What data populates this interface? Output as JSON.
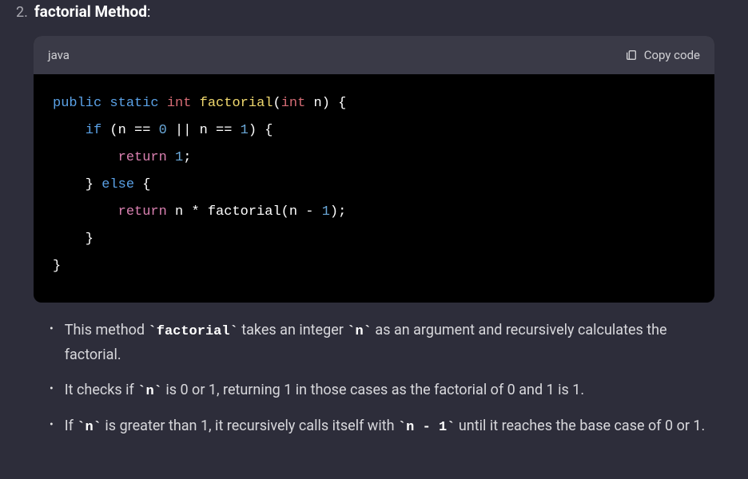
{
  "heading": {
    "number": "2.",
    "title": "factorial Method",
    "colon": ":"
  },
  "code_block": {
    "language": "java",
    "copy_label": "Copy code",
    "tokens": [
      {
        "t": "public",
        "c": "tok-keyword"
      },
      {
        "t": " "
      },
      {
        "t": "static",
        "c": "tok-keyword"
      },
      {
        "t": " "
      },
      {
        "t": "int",
        "c": "tok-type"
      },
      {
        "t": " "
      },
      {
        "t": "factorial",
        "c": "tok-func"
      },
      {
        "t": "("
      },
      {
        "t": "int",
        "c": "tok-type"
      },
      {
        "t": " n) {\n"
      },
      {
        "t": "    "
      },
      {
        "t": "if",
        "c": "tok-keyword"
      },
      {
        "t": " (n == "
      },
      {
        "t": "0",
        "c": "tok-number"
      },
      {
        "t": " || n == "
      },
      {
        "t": "1",
        "c": "tok-number"
      },
      {
        "t": ") {\n"
      },
      {
        "t": "        "
      },
      {
        "t": "return",
        "c": "tok-return"
      },
      {
        "t": " "
      },
      {
        "t": "1",
        "c": "tok-number"
      },
      {
        "t": ";\n"
      },
      {
        "t": "    } "
      },
      {
        "t": "else",
        "c": "tok-keyword"
      },
      {
        "t": " {\n"
      },
      {
        "t": "        "
      },
      {
        "t": "return",
        "c": "tok-return"
      },
      {
        "t": " n * factorial(n - "
      },
      {
        "t": "1",
        "c": "tok-number"
      },
      {
        "t": ");\n"
      },
      {
        "t": "    }\n"
      },
      {
        "t": "}"
      }
    ]
  },
  "bullets": [
    {
      "segments": [
        {
          "text": "This method "
        },
        {
          "text": "`factorial`",
          "code": true
        },
        {
          "text": " takes an integer "
        },
        {
          "text": "`n`",
          "code": true
        },
        {
          "text": " as an argument and recursively calculates the factorial."
        }
      ]
    },
    {
      "segments": [
        {
          "text": "It checks if "
        },
        {
          "text": "`n`",
          "code": true
        },
        {
          "text": " is 0 or 1, returning 1 in those cases as the factorial of 0 and 1 is 1."
        }
      ]
    },
    {
      "segments": [
        {
          "text": "If "
        },
        {
          "text": "`n`",
          "code": true
        },
        {
          "text": " is greater than 1, it recursively calls itself with "
        },
        {
          "text": "`n - 1`",
          "code": true
        },
        {
          "text": " until it reaches the base case of 0 or 1."
        }
      ]
    }
  ]
}
